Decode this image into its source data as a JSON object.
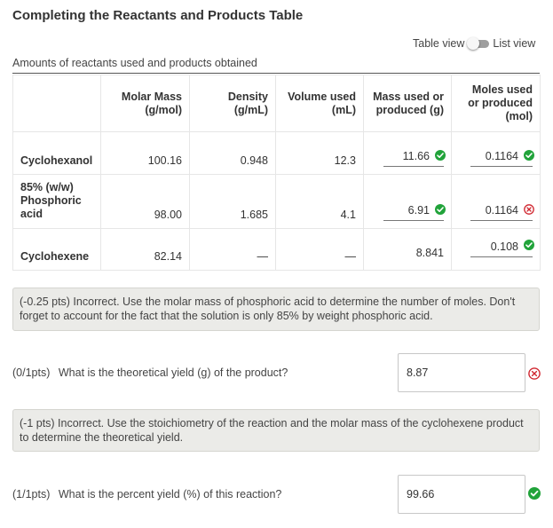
{
  "page": {
    "title": "Completing the Reactants and Products Table"
  },
  "view_toggle": {
    "left_label": "Table view",
    "right_label": "List view"
  },
  "table": {
    "caption": "Amounts of reactants used and products obtained",
    "headers": {
      "molar_mass": "Molar Mass (g/mol)",
      "density": "Density (g/mL)",
      "volume": "Volume used (mL)",
      "mass": "Mass used or produced (g)",
      "moles": "Moles used or produced (mol)"
    },
    "rows": [
      {
        "name": "Cyclohexanol",
        "molar_mass": "100.16",
        "density": "0.948",
        "volume": "12.3",
        "mass": "11.66",
        "mass_status": "correct",
        "moles": "0.1164",
        "moles_status": "correct"
      },
      {
        "name": "85% (w/w) Phosphoric acid",
        "molar_mass": "98.00",
        "density": "1.685",
        "volume": "4.1",
        "mass": "6.91",
        "mass_status": "correct",
        "moles": "0.1164",
        "moles_status": "incorrect"
      },
      {
        "name": "Cyclohexene",
        "molar_mass": "82.14",
        "density": "—",
        "volume": "—",
        "mass": "8.841",
        "moles": "0.108",
        "moles_status": "correct"
      }
    ]
  },
  "feedback_1": "(-0.25 pts) Incorrect. Use the molar mass of phosphoric acid to determine the number of moles. Don't forget to account for the fact that the solution is only 85% by weight phosphoric acid.",
  "question_1": {
    "points": "(0/1pts)",
    "text": "What is the theoretical yield (g) of the product?",
    "answer": "8.87",
    "status": "incorrect"
  },
  "feedback_2": "(-1 pts) Incorrect. Use the stoichiometry of the reaction and the molar mass of the cyclohexene product to determine the theoretical yield.",
  "question_2": {
    "points": "(1/1pts)",
    "text": "What is the percent yield (%) of this reaction?",
    "answer": "99.66",
    "status": "correct"
  },
  "colors": {
    "correct": "#21a33a",
    "incorrect": "#d0262f",
    "feedback_bg": "#ebebe8"
  },
  "icons": {
    "correct": "check-circle-icon",
    "incorrect": "x-circle-icon"
  }
}
